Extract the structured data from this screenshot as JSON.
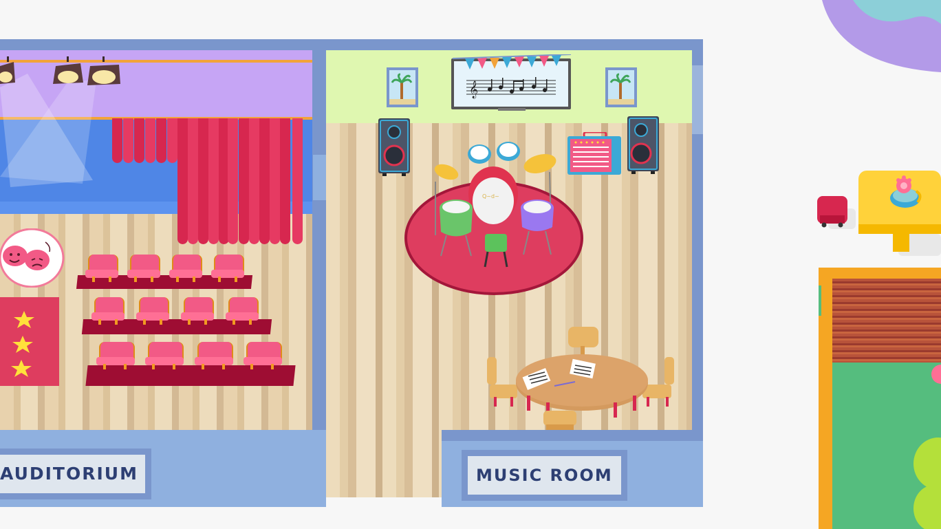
{
  "rooms": {
    "auditorium": {
      "label": "AUDITORIUM"
    },
    "music_room": {
      "label": "MUSIC ROOM"
    }
  },
  "colors": {
    "wall_blue": "#7a96cc",
    "floor_wood": "#e6cfa8",
    "rug_red": "#de3d5f",
    "seat_pink": "#f25a86",
    "stage_purple": "#c6a5f5",
    "music_wall_green": "#dff7b0"
  },
  "icons": {
    "drum_kit": "drum-kit-icon",
    "speaker": "speaker-icon",
    "amplifier": "amplifier-icon",
    "spotlight": "spotlight-icon",
    "comedy_tragedy_masks": "theater-masks-icon",
    "star": "star-icon",
    "sheet_music": "sheet-music-icon"
  }
}
